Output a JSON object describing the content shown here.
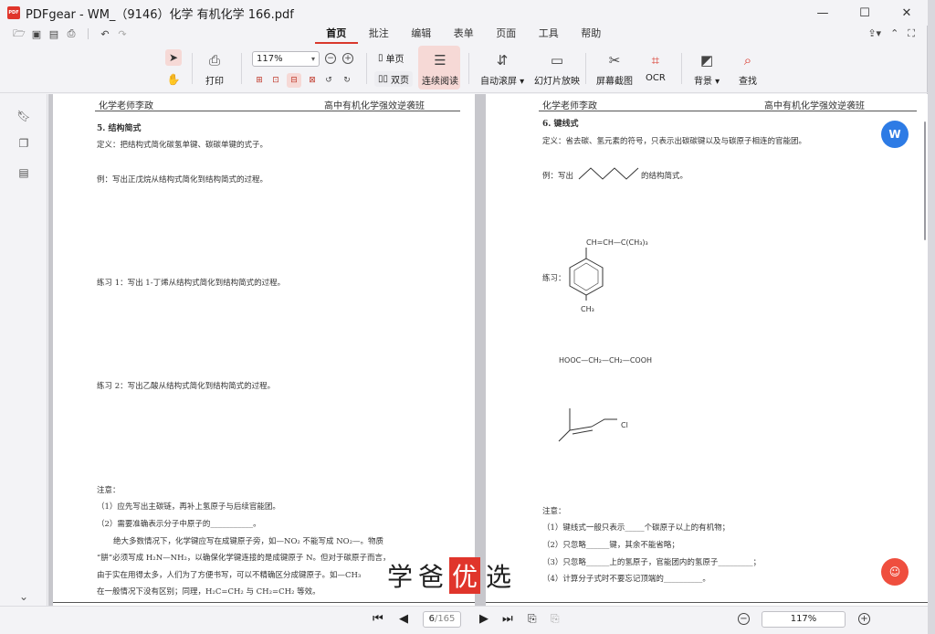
{
  "window": {
    "title": "PDFgear - WM_（9146）化学 有机化学 166.pdf",
    "logo_text": "PDF",
    "minimize": "—",
    "maximize": "☐",
    "close": "✕"
  },
  "menu": {
    "tabs": [
      {
        "label": "首页",
        "active": true
      },
      {
        "label": "批注"
      },
      {
        "label": "编辑"
      },
      {
        "label": "表单"
      },
      {
        "label": "页面"
      },
      {
        "label": "工具"
      },
      {
        "label": "帮助"
      }
    ]
  },
  "ribbon": {
    "print": "打印",
    "zoom": "117%",
    "single_page": "单页",
    "double_page": "双页",
    "continuous": "连续阅读",
    "auto_scroll": "自动滚屏",
    "slideshow": "幻灯片放映",
    "screenshot": "屏幕截图",
    "ocr": "OCR",
    "background": "背景",
    "find": "查找"
  },
  "left_page": {
    "header_left": "化学老师李政",
    "header_right": "高中有机化学强效逆袭班",
    "section": "5. 结构简式",
    "definition": "定义：把结构式简化碳氢单键、碳碳单键的式子。",
    "example": "例：写出正戊烷从结构式简化到结构简式的过程。",
    "exercise1": "练习 1：写出 1-丁烯从结构式简化到结构简式的过程。",
    "exercise2": "练习 2：写出乙酸从结构式简化到结构简式的过程。",
    "notes_title": "注意：",
    "note1": "（1）应先写出主碳链，再补上氢原子与后续官能团。",
    "note2": "（2）需要准确表示分子中原子的___________。",
    "para1": "绝大多数情况下，化学键应写在成键原子旁，如—NO₂ 不能写成 NO₂—。物质",
    "para2": "“肼”必须写成 H₂N—NH₂，以确保化学键连接的是成键原子 N。但对于碳原子而言，",
    "para3": "由于实在用得太多，人们为了方便书写，可以不精确区分成键原子。如—CH₃",
    "para4": "在一般情况下没有区别；同理，H₂C=CH₂ 与 CH₂=CH₂ 等效。"
  },
  "right_page": {
    "header_left": "化学老师李政",
    "header_right": "高中有机化学强效逆袭班",
    "section": "6. 键线式",
    "definition": "定义：省去碳、氢元素的符号，只表示出碳碳键以及与碳原子相连的官能团。",
    "example_prefix": "例：写出",
    "example_suffix": "的结构简式。",
    "exercise": "练习：",
    "chain_label": "CH=CH—C(CH₃)₃",
    "methyl_label": "CH₃",
    "diacid": "HOOC—CH₂—CH₂—COOH",
    "cl_label": "Cl",
    "notes_title": "注意：",
    "note1": "（1）键线式一般只表示_____个碳原子以上的有机物；",
    "note2": "（2）只忽略______键，其余不能省略；",
    "note3": "（3）只忽略______上的氢原子，官能团内的氢原子_________；",
    "note4": "（4）计算分子式时不要忘记顶端的__________。"
  },
  "watermark": {
    "c1": "学",
    "c2": "爸",
    "c3": "优",
    "c4": "选"
  },
  "float_buttons": {
    "word": "W"
  },
  "statusbar": {
    "current_page": "6",
    "total_pages": "/165",
    "zoom": "117%"
  }
}
